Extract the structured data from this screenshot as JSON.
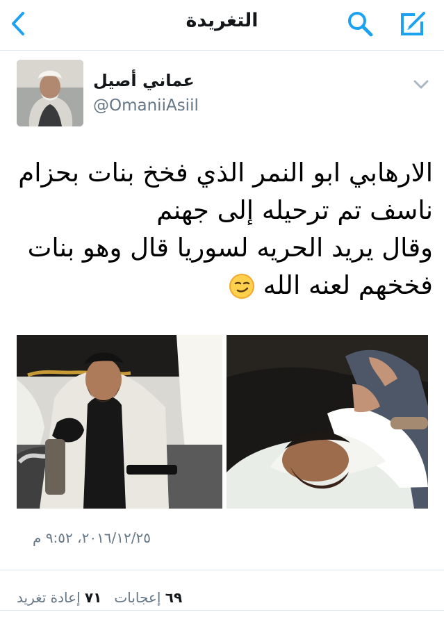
{
  "header": {
    "title": "التغريدة",
    "back_icon": "chevron-left-icon",
    "search_icon": "search-icon",
    "compose_icon": "compose-icon",
    "accent_color": "#1da1f2"
  },
  "tweet": {
    "author_name": "عماني أصيل",
    "author_handle": "@OmaniiAsiil",
    "text_lines": [
      "الارهابي ابو النمر الذي فخخ بنات بحزام",
      "ناسف تم ترحيله إلى جهنم",
      "وقال يريد الحريه لسوريا قال وهو بنات",
      "فخخهم لعنه الله"
    ],
    "timestamp": "٢٠١٦/١٢/٢٥، ٩:٥٢ م",
    "likes_count": "٦٩",
    "likes_label": "إعجابات",
    "retweets_count": "٧١",
    "retweets_label": "إعادة تغريد"
  }
}
